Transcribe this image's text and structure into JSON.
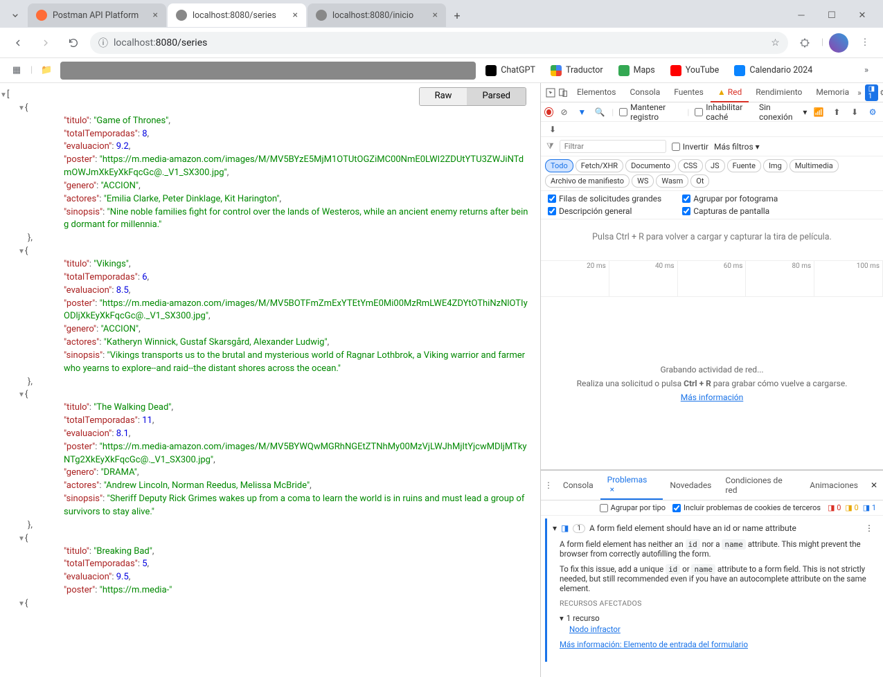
{
  "tabs": [
    {
      "title": "Postman API Platform",
      "active": false
    },
    {
      "title": "localhost:8080/series",
      "active": true
    },
    {
      "title": "localhost:8080/inicio",
      "active": false
    }
  ],
  "urlHost": "localhost:",
  "urlPath": "8080/series",
  "bookmarks": {
    "chatgpt": "ChatGPT",
    "translator": "Traductor",
    "maps": "Maps",
    "youtube": "YouTube",
    "calendar": "Calendario 2024"
  },
  "jsonToggle": {
    "raw": "Raw",
    "parsed": "Parsed"
  },
  "jsonData": [
    {
      "titulo": "Game of Thrones",
      "totalTemporadas": 8,
      "evaluacion": 9.2,
      "poster": "https://m.media-amazon.com/images/M/MV5BYzE5MjM1OTUtOGZiMC00NmE0LWI2ZDUtYTU3ZWJiNTdmOWJmXkEyXkFqcGc@._V1_SX300.jpg",
      "genero": "ACCION",
      "actores": "Emilia Clarke, Peter Dinklage, Kit Harington",
      "sinopsis": "Nine noble families fight for control over the lands of Westeros, while an ancient enemy returns after being dormant for millennia."
    },
    {
      "titulo": "Vikings",
      "totalTemporadas": 6,
      "evaluacion": 8.5,
      "poster": "https://m.media-amazon.com/images/M/MV5BOTFmZmExYTEtYmE0Mi00MzRmLWE4ZDYtOThiNzNlOTIyODljXkEyXkFqcGc@._V1_SX300.jpg",
      "genero": "ACCION",
      "actores": "Katheryn Winnick, Gustaf Skarsgård, Alexander Ludwig",
      "sinopsis": "Vikings transports us to the brutal and mysterious world of Ragnar Lothbrok, a Viking warrior and farmer who yearns to explore--and raid--the distant shores across the ocean."
    },
    {
      "titulo": "The Walking Dead",
      "totalTemporadas": 11,
      "evaluacion": 8.1,
      "poster": "https://m.media-amazon.com/images/M/MV5BYWQwMGRhNGEtZTNhMy00MzVjLWJhMjItYjcwMDljMTkyNTg2XkEyXkFqcGc@._V1_SX300.jpg",
      "genero": "DRAMA",
      "actores": "Andrew Lincoln, Norman Reedus, Melissa McBride",
      "sinopsis": "Sheriff Deputy Rick Grimes wakes up from a coma to learn the world is in ruins and must lead a group of survivors to stay alive."
    },
    {
      "titulo": "Breaking Bad",
      "totalTemporadas": 5,
      "evaluacion": 9.5,
      "poster": "https://m.media-"
    }
  ],
  "devtools": {
    "topTabs": {
      "elements": "Elementos",
      "console": "Consola",
      "sources": "Fuentes",
      "network": "Red",
      "performance": "Rendimiento",
      "memory": "Memoria"
    },
    "issueBadge": "1",
    "toolbar": {
      "preserve": "Mantener registro",
      "disableCache": "Inhabilitar caché",
      "offline": "Sin conexión"
    },
    "filter": {
      "placeholder": "Filtrar",
      "invert": "Invertir",
      "more": "Más filtros"
    },
    "types": [
      "Todo",
      "Fetch/XHR",
      "Documento",
      "CSS",
      "JS",
      "Fuente",
      "Img",
      "Multimedia",
      "Archivo de manifiesto",
      "WS",
      "Wasm",
      "Ot"
    ],
    "checks": {
      "large": "Filas de solicitudes grandes",
      "frame": "Agrupar por fotograma",
      "overview": "Descripción general",
      "screenshots": "Capturas de pantalla"
    },
    "wfHint": "Pulsa Ctrl + R para volver a cargar y capturar la tira de película.",
    "timeMarks": [
      "20 ms",
      "40 ms",
      "60 ms",
      "80 ms",
      "100 ms"
    ],
    "recording": {
      "title": "Grabando actividad de red...",
      "hint_a": "Realiza una solicitud o pulsa ",
      "hint_b": "Ctrl + R",
      "hint_c": " para grabar cómo vuelve a cargarse.",
      "more": "Más información"
    },
    "drawerTabs": {
      "console": "Consola",
      "issues": "Problemas",
      "news": "Novedades",
      "netcond": "Condiciones de red",
      "anim": "Animaciones"
    },
    "issuesToolbar": {
      "group": "Agrupar por tipo",
      "cookies": "Incluir problemas de cookies de terceros"
    },
    "issueCounts": {
      "red": "0",
      "yellow": "0",
      "blue": "1"
    },
    "issue": {
      "badge": "1",
      "title": "A form field element should have an id or name attribute",
      "p1a": "A form field element has neither an ",
      "p1b": " nor a ",
      "p1c": " attribute. This might prevent the browser from correctly autofilling the form.",
      "p2a": "To fix this issue, add a unique ",
      "p2b": " or ",
      "p2c": " attribute to a form field. This is not strictly needed, but still recommended even if you have an autocomplete attribute on the same element.",
      "code_id": "id",
      "code_name": "name",
      "affected": "RECURSOS AFECTADOS",
      "resCount": "1 recurso",
      "offender": "Nodo infractor",
      "moreInfo": "Más información: Elemento de entrada del formulario"
    }
  }
}
